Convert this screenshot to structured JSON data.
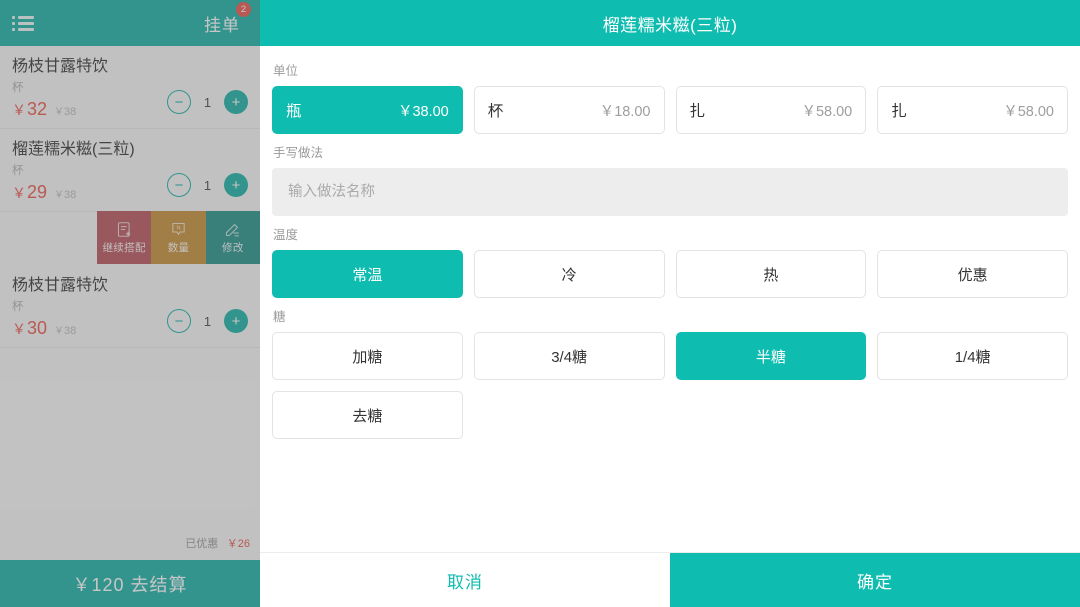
{
  "order_panel": {
    "header": {
      "menu_icon": "list-menu-icon",
      "hold_label": "挂单",
      "hold_badge": "2"
    },
    "items": [
      {
        "name": "杨枝甘露特饮",
        "unit": "杯",
        "price": "32",
        "currency": "￥",
        "original_price": "38",
        "qty": "1",
        "minus_icon": "minus-icon",
        "plus_icon": "plus-icon"
      },
      {
        "name": "榴莲糯米糍(三粒)",
        "unit": "杯",
        "price": "29",
        "currency": "￥",
        "original_price": "38",
        "qty": "1",
        "minus_icon": "minus-icon",
        "plus_icon": "plus-icon"
      },
      {
        "name": "杨枝甘露特饮",
        "unit": "杯",
        "price": "30",
        "currency": "￥",
        "original_price": "38",
        "qty": "1",
        "minus_icon": "minus-icon",
        "plus_icon": "plus-icon"
      }
    ],
    "actions": [
      {
        "label": "继续搭配",
        "icon": "document-plus-icon",
        "color": "#b0424c"
      },
      {
        "label": "数量",
        "icon": "number-tag-icon",
        "color": "#c08424"
      },
      {
        "label": "修改",
        "icon": "pencil-edit-icon",
        "color": "#0d877c"
      }
    ],
    "discount": {
      "label": "已优惠",
      "amount": "￥26"
    },
    "checkout": {
      "label": "￥120 去结算"
    }
  },
  "detail_panel": {
    "title": "榴莲糯米糍(三粒)",
    "sections": [
      {
        "key": "unit",
        "label": "单位",
        "options": [
          {
            "name": "瓶",
            "price": "￥38.00",
            "selected": true
          },
          {
            "name": "杯",
            "price": "￥18.00",
            "selected": false
          },
          {
            "name": "扎",
            "price": "￥58.00",
            "selected": false
          },
          {
            "name": "扎",
            "price": "￥58.00",
            "selected": false
          }
        ]
      },
      {
        "key": "handwrite",
        "label": "手写做法",
        "input_value": "",
        "input_placeholder": "输入做法名称"
      },
      {
        "key": "temperature",
        "label": "温度",
        "options": [
          {
            "name": "常温",
            "selected": true
          },
          {
            "name": "冷",
            "selected": false
          },
          {
            "name": "热",
            "selected": false
          },
          {
            "name": "优惠",
            "selected": false
          }
        ]
      },
      {
        "key": "sugar",
        "label": "糖",
        "options": [
          {
            "name": "加糖",
            "selected": false
          },
          {
            "name": "3/4糖",
            "selected": false
          },
          {
            "name": "半糖",
            "selected": true
          },
          {
            "name": "1/4糖",
            "selected": false
          },
          {
            "name": "去糖",
            "selected": false
          }
        ]
      }
    ],
    "footer": {
      "cancel_label": "取消",
      "confirm_label": "确定"
    }
  },
  "colors": {
    "brand_teal": "#00a99d",
    "header_teal": "#0fbcb0",
    "price_red": "#e8443a",
    "badge_red": "#e8443a"
  }
}
